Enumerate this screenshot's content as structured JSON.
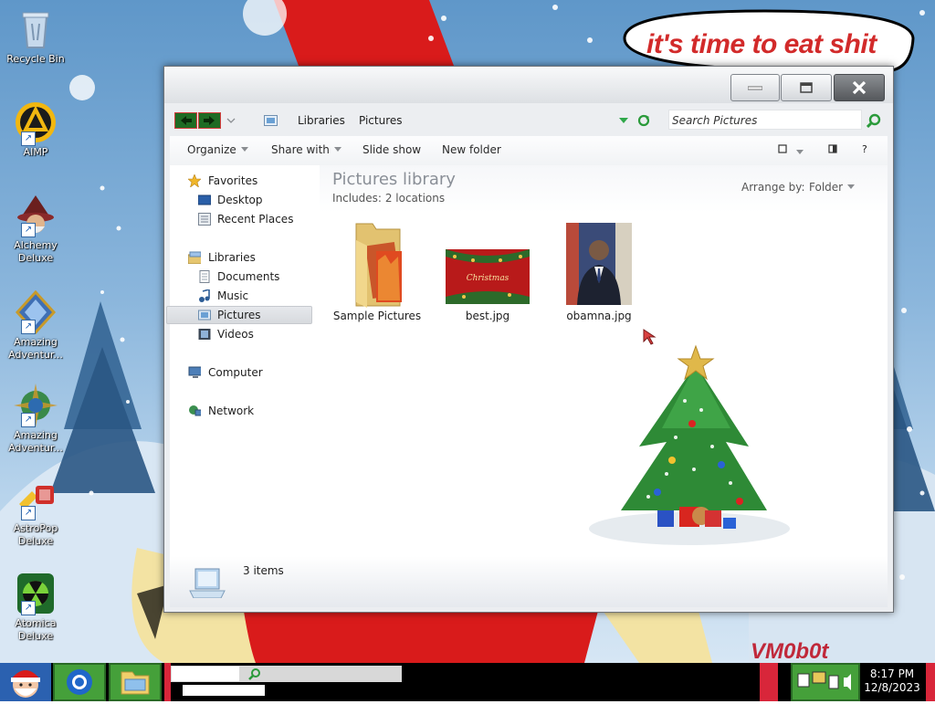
{
  "wallpaper": {
    "banner_text": "it's time to eat shit",
    "signature": "VM0b0t"
  },
  "desktop_icons": [
    {
      "label": "Recycle Bin",
      "icon": "recycle-bin-icon"
    },
    {
      "label": "AIMP",
      "icon": "aimp-icon"
    },
    {
      "label": "Alchemy Deluxe",
      "icon": "alchemy-icon"
    },
    {
      "label": "Amazing Adventur...",
      "icon": "amazing-adventures-icon"
    },
    {
      "label": "Amazing Adventur...",
      "icon": "amazing-adventures-globe-icon"
    },
    {
      "label": "AstroPop Deluxe",
      "icon": "astropop-icon"
    },
    {
      "label": "Atomica Deluxe",
      "icon": "atomica-icon"
    }
  ],
  "window": {
    "breadcrumb": [
      "Libraries",
      "Pictures"
    ],
    "search_placeholder": "Search Pictures",
    "toolbar": {
      "organize": "Organize",
      "share_with": "Share with",
      "slide_show": "Slide show",
      "new_folder": "New folder"
    },
    "nav": {
      "favorites": "Favorites",
      "desktop": "Desktop",
      "recent_places": "Recent Places",
      "libraries": "Libraries",
      "documents": "Documents",
      "music": "Music",
      "pictures": "Pictures",
      "videos": "Videos",
      "computer": "Computer",
      "network": "Network"
    },
    "library": {
      "title": "Pictures library",
      "includes": "Includes:",
      "locations": "2 locations",
      "arrange_by": "Arrange by:",
      "arrange_value": "Folder"
    },
    "files": [
      {
        "name": "Sample Pictures",
        "type": "folder"
      },
      {
        "name": "best.jpg",
        "type": "image"
      },
      {
        "name": "obamna.jpg",
        "type": "image"
      }
    ],
    "status": "3 items",
    "help": "?"
  },
  "taskbar": {
    "time": "8:17 PM",
    "date": "12/8/2023"
  },
  "colors": {
    "banner_red": "#d22a2a",
    "nav_back_green": "#1e6b24",
    "taskbar": "#000000"
  }
}
